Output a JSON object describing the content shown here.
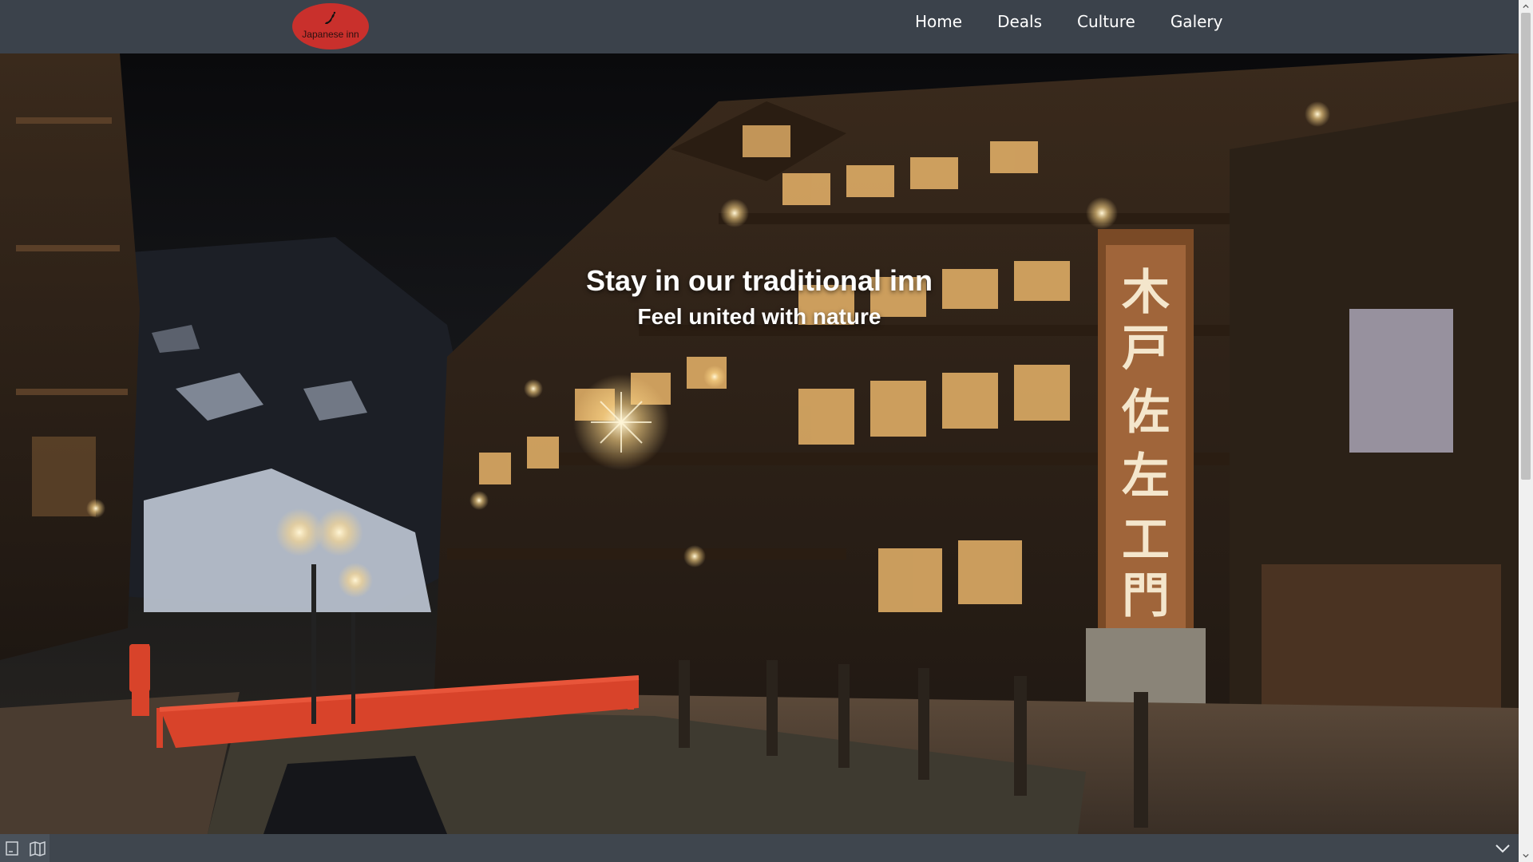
{
  "header": {
    "logo_text": "Japanese inn",
    "nav": [
      "Home",
      "Deals",
      "Culture",
      "Galery"
    ]
  },
  "hero": {
    "title": "Stay in our traditional inn",
    "subtitle": "Feel united with nature"
  },
  "colors": {
    "navbar": "#3b424b",
    "logo": "#c9302c",
    "bridge": "#d8432a",
    "lantern": "#ffd98a"
  },
  "icons": {
    "logo": "japan-map-icon",
    "bottom_left_1": "page-icon",
    "bottom_left_2": "map-icon",
    "bottom_right": "chevron-down-icon"
  }
}
